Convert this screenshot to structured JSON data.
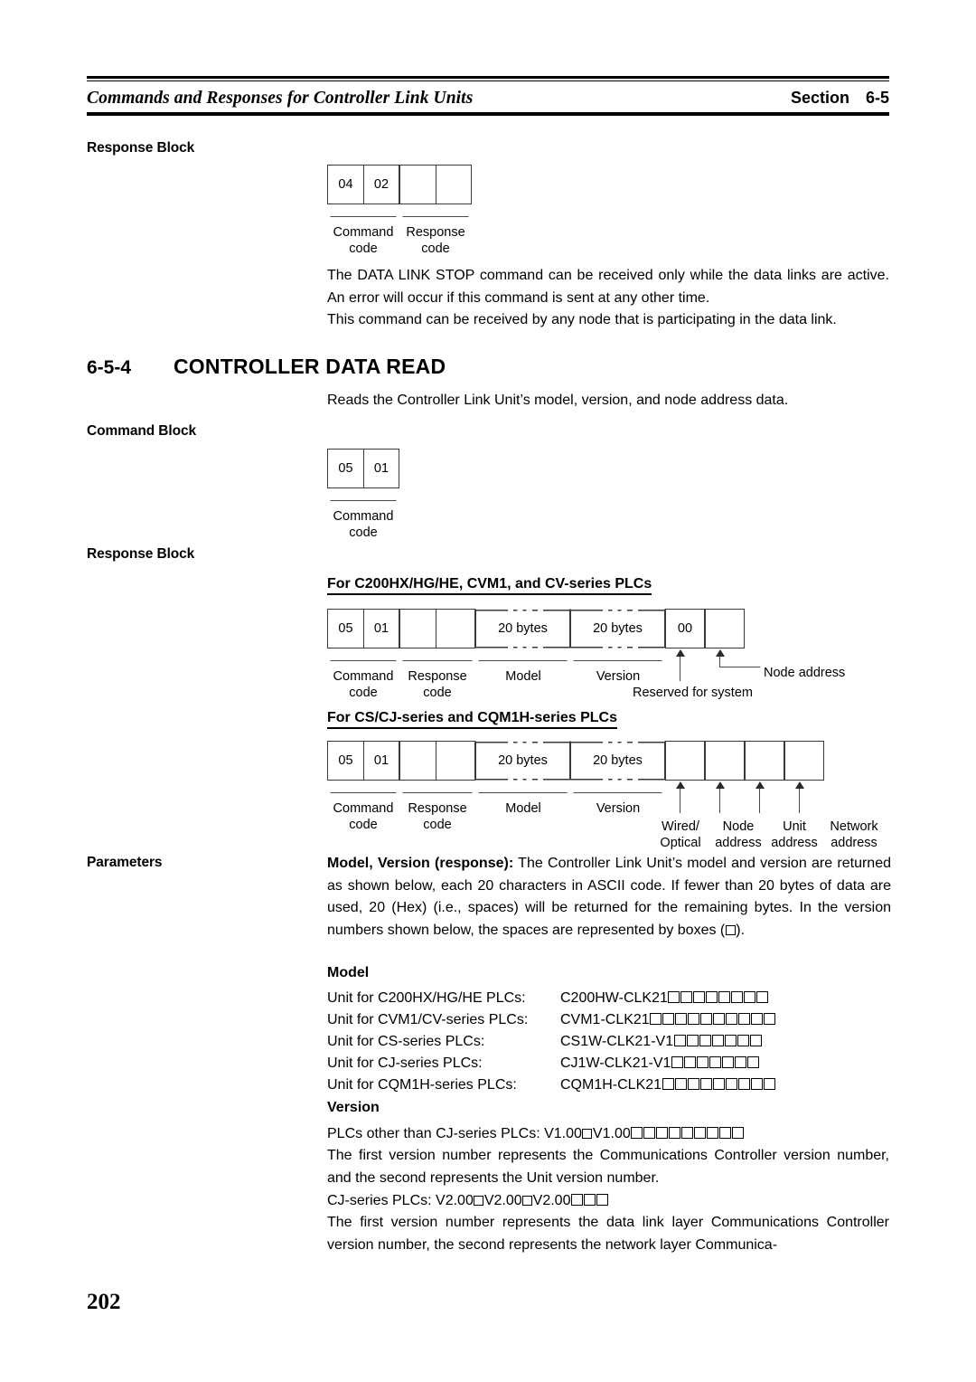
{
  "header": {
    "title": "Commands and Responses for Controller Link Units",
    "section_label": "Section",
    "section_number": "6-5"
  },
  "page_number": "202",
  "blocks": {
    "response_block_1_label": "Response Block",
    "command_block_label": "Command Block",
    "response_block_2_label": "Response Block",
    "parameters_label": "Parameters"
  },
  "diagram_response_stop": {
    "cells": [
      "04",
      "02",
      "",
      ""
    ],
    "labels": [
      "Command\ncode",
      "Response\ncode"
    ],
    "label_command": "Command",
    "label_command2": "code",
    "label_response": "Response",
    "label_response2": "code"
  },
  "paragraphs": {
    "p1": "The DATA LINK STOP command can be received only while the data links are active. An error will occur if this command is sent at any other time.",
    "p2": "This command can be received by any node that is participating in the data link.",
    "p3": "Reads the Controller Link Unit’s model, version, and node address data."
  },
  "section_heading": {
    "number": "6-5-4",
    "title": "CONTROLLER DATA READ"
  },
  "diagram_command_read": {
    "cells": [
      "05",
      "01"
    ],
    "label_command": "Command",
    "label_command2": "code"
  },
  "diagram_resp_a": {
    "subhead": "For C200HX/HG/HE, CVM1, and CV-series PLCs",
    "cells": [
      "05",
      "01",
      "",
      "",
      "20 bytes",
      "20 bytes",
      "00",
      ""
    ],
    "label_command": "Command",
    "label_command2": "code",
    "label_response": "Response",
    "label_response2": "code",
    "label_model": "Model",
    "label_version": "Version",
    "label_reserved": "Reserved for system",
    "label_node": "Node address"
  },
  "diagram_resp_b": {
    "subhead": "For CS/CJ-series and CQM1H-series PLCs",
    "cells": [
      "05",
      "01",
      "",
      "",
      "20 bytes",
      "20 bytes",
      "",
      "",
      "",
      ""
    ],
    "label_command": "Command",
    "label_command2": "code",
    "label_response": "Response",
    "label_response2": "code",
    "label_model": "Model",
    "label_version": "Version",
    "label_wired": "Wired/",
    "label_wired2": "Optical",
    "label_node": "Node",
    "label_node2": "address",
    "label_unit": "Unit",
    "label_unit2": "address",
    "label_network": "Network",
    "label_network2": "address"
  },
  "parameters": {
    "lead_bold": "Model, Version (response):",
    "lead_rest": " The Controller Link Unit’s model and version are returned as shown below, each 20 characters in ASCII code. If fewer than 20 bytes of data are used, 20 (Hex) (i.e., spaces) will be returned for the remaining bytes. In the version numbers shown below, the spaces are represented by boxes (",
    "lead_tail": ").",
    "model_heading": "Model",
    "models": [
      {
        "label": "Unit for C200HX/HG/HE PLCs:",
        "value": "C200HW-CLK21",
        "boxes": 8
      },
      {
        "label": "Unit for CVM1/CV-series PLCs:",
        "value": "CVM1-CLK21",
        "boxes": 10
      },
      {
        "label": "Unit for CS-series PLCs:",
        "value": "CS1W-CLK21-V1",
        "boxes": 7
      },
      {
        "label": "Unit for CJ-series PLCs:",
        "value": "CJ1W-CLK21-V1",
        "boxes": 7
      },
      {
        "label": "Unit for CQM1H-series PLCs:",
        "value": "CQM1H-CLK21",
        "boxes": 9
      }
    ],
    "version_heading": "Version",
    "version_other_label": "PLCs other than CJ-series PLCs:",
    "version_other_v1": "V1.00",
    "version_other_v2": "V1.00",
    "version_other_boxes": 9,
    "version_other_note": "The first version number represents the Communications Controller version number, and the second represents the Unit version number.",
    "version_cj_label": "CJ-series PLCs:",
    "version_cj_v1": "V2.00",
    "version_cj_v2": "V2.00",
    "version_cj_v3": "V2.00",
    "version_cj_boxes": 3,
    "version_cj_note": "The first version number represents the data link layer Communications Controller version number, the second represents the network layer Communica-"
  }
}
